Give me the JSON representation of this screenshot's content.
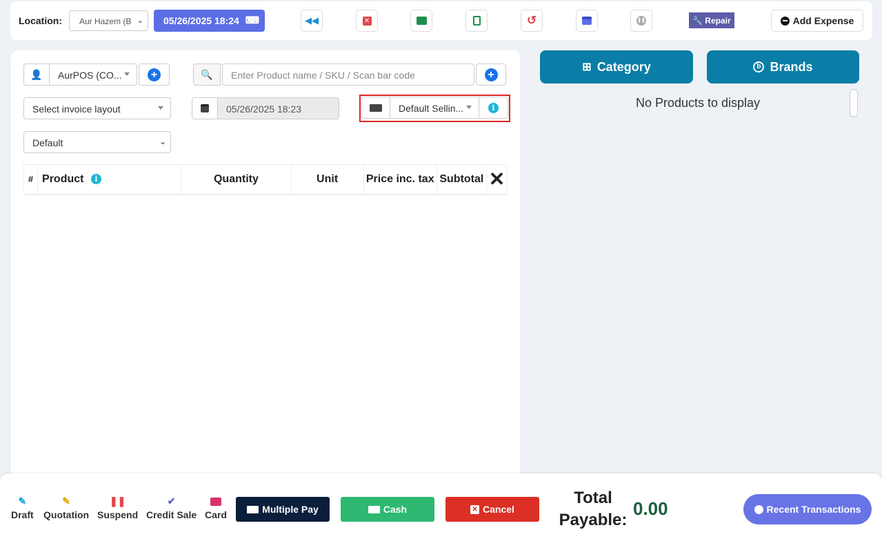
{
  "topbar": {
    "location_label": "Location:",
    "location_value": "Aur Hazem (B",
    "datetime": "05/26/2025 18:24",
    "repair_label": "Repair",
    "add_expense_label": "Add Expense"
  },
  "form": {
    "customer_value": "AurPOS (CO...",
    "product_search_placeholder": "Enter Product name / SKU / Scan bar code",
    "invoice_layout_value": "Select invoice layout",
    "transaction_date": "05/26/2025 18:23",
    "price_group_value": "Default Sellin...",
    "service_type_value": "Default"
  },
  "cart_table": {
    "columns": [
      "#",
      "Product",
      "Quantity",
      "Unit",
      "Price inc. tax",
      "Subtotal"
    ]
  },
  "right_panel": {
    "category_label": "Category",
    "brands_label": "Brands",
    "no_products": "No Products to display"
  },
  "bottombar": {
    "actions": [
      {
        "label": "Draft",
        "color": "#1aa3d9"
      },
      {
        "label": "Quotation",
        "color": "#e6a700"
      },
      {
        "label": "Suspend",
        "color": "#e0474c"
      },
      {
        "label": "Credit Sale",
        "color": "#5b5fc7"
      },
      {
        "label": "Card",
        "color": "#d6336c"
      }
    ],
    "multiple_pay_label": "Multiple Pay",
    "cash_label": "Cash",
    "cancel_label": "Cancel",
    "total_payable_label": "Total Payable:",
    "total_payable_value": "0.00",
    "recent_transactions_label": "Recent Transactions"
  },
  "colors": {
    "accent_blue": "#5b6ee6",
    "category_teal": "#0a7ea6",
    "cash_green": "#2eb872",
    "cancel_red": "#dc2f25",
    "multiple_pay_navy": "#0b1e3b",
    "highlight_red": "#dc2626"
  }
}
